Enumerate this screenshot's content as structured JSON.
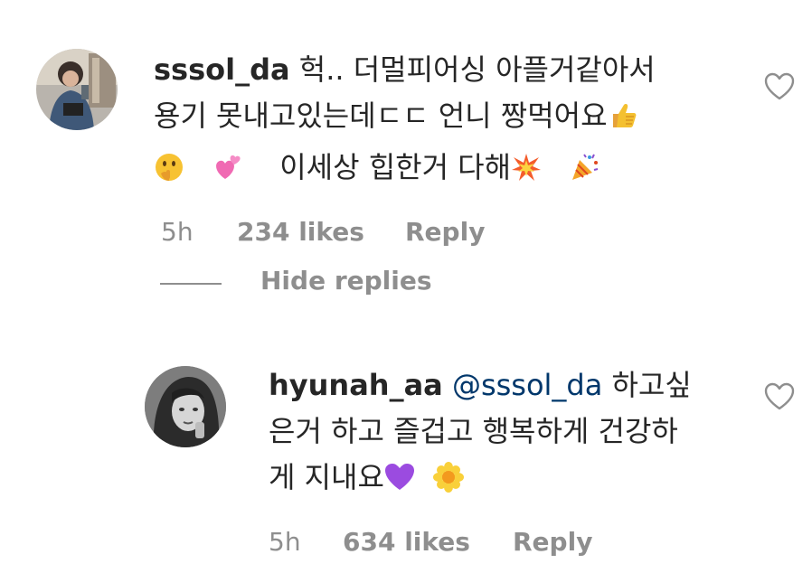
{
  "comments": [
    {
      "username": "sssol_da",
      "lines": [
        "헉.. 더멀피어싱 아플거같아서",
        "용기 못내고있는데ㄷㄷ 언니 짱먹어요",
        "이세상 힙한거 다해"
      ],
      "emojis": [
        "thumbs-up",
        "shushing-face",
        "two-hearts",
        "collision",
        "party-popper"
      ],
      "time": "5h",
      "likes": "234 likes",
      "reply": "Reply"
    }
  ],
  "hide_replies": "Hide replies",
  "replies": [
    {
      "username": "hyunah_aa",
      "mention": "@sssol_da",
      "lines": [
        "하고싶",
        "은거 하고 즐겁고 행복하게 건강하",
        "게 지내요"
      ],
      "emojis": [
        "purple-heart",
        "blossom"
      ],
      "time": "5h",
      "likes": "634 likes",
      "reply": "Reply"
    }
  ],
  "colors": {
    "text": "#262626",
    "secondary": "#8e8e8e",
    "mention": "#00376b"
  }
}
